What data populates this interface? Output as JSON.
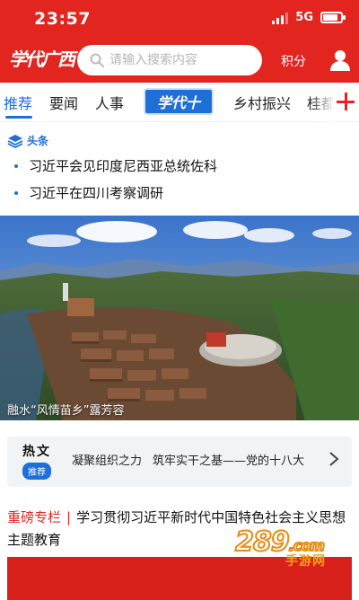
{
  "status_bar": {
    "time": "23:57",
    "network": "5G",
    "signal_level": 3,
    "battery_level": 0.85
  },
  "header": {
    "logo_text": "学代广西",
    "search_placeholder": "请输入搜索内容",
    "points_label": "积分",
    "accent_color": "#e32520"
  },
  "tabs": [
    {
      "label": "推荐",
      "active": true
    },
    {
      "label": "要闻"
    },
    {
      "label": "人事"
    },
    {
      "label": "学代十"
    },
    {
      "label": "乡村振兴"
    },
    {
      "label": "桂都"
    }
  ],
  "headlines": {
    "label": "头条",
    "items": [
      "习近平会见印度尼西亚总统佐科",
      "习近平在四川考察调研"
    ]
  },
  "photo": {
    "caption": "融水“风情苗乡”露芳容"
  },
  "hot": {
    "title": "热文",
    "tag": "推荐",
    "items": [
      "凝聚组织之力",
      "筑牢实干之基——党的十八大"
    ]
  },
  "column": {
    "tag": "重磅专栏",
    "separator": "|",
    "title": "学习贯彻习近平新时代中国特色社会主义思想主题教育"
  },
  "watermark": {
    "brand": "289",
    "suffix": ".com",
    "sub": "手游网"
  },
  "colors": {
    "brand_red": "#e32520",
    "blue": "#1f6fd8"
  },
  "icons": [
    "search-icon",
    "user-icon",
    "plus-icon",
    "layers-icon",
    "chevron-right-icon"
  ]
}
